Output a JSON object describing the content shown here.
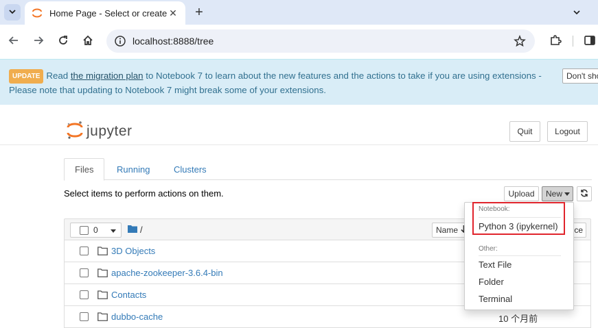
{
  "browser": {
    "tab_title": "Home Page - Select or create a notebook",
    "tab_close": "✕",
    "new_tab": "+",
    "url": "localhost:8888/tree"
  },
  "banner": {
    "badge": "UPDATE",
    "pre_link": "Read ",
    "link": "the migration plan",
    "post_link": " to Notebook 7 to learn about the new features and the actions to take if you are using extensions - Please note that updating to Notebook 7 might break some of your extensions.",
    "dismiss_button": "Don't show"
  },
  "header": {
    "logo_text": "jupyter",
    "quit_label": "Quit",
    "logout_label": "Logout"
  },
  "tabs": [
    {
      "label": "Files"
    },
    {
      "label": "Running"
    },
    {
      "label": "Clusters"
    }
  ],
  "actions": {
    "select_message": "Select items to perform actions on them.",
    "upload_label": "Upload",
    "new_label": "New",
    "refresh_icon": "refresh-icon"
  },
  "list": {
    "selected_count": "0",
    "breadcrumb": "/",
    "name_sort_label": "Name",
    "hidden_label": "ce",
    "rows": [
      {
        "name": "3D Objects",
        "modified": ""
      },
      {
        "name": "apache-zookeeper-3.6.4-bin",
        "modified": ""
      },
      {
        "name": "Contacts",
        "modified": ""
      },
      {
        "name": "dubbo-cache",
        "modified": "10 个月前"
      }
    ]
  },
  "new_menu": {
    "notebook_header": "Notebook:",
    "python_kernel": "Python 3 (ipykernel)",
    "other_header": "Other:",
    "text_file": "Text File",
    "folder": "Folder",
    "terminal": "Terminal"
  },
  "colors": {
    "accent": "#337ab7",
    "banner_bg": "#d9edf7",
    "highlight": "#e0232b",
    "jupyter_orange": "#f37626"
  }
}
